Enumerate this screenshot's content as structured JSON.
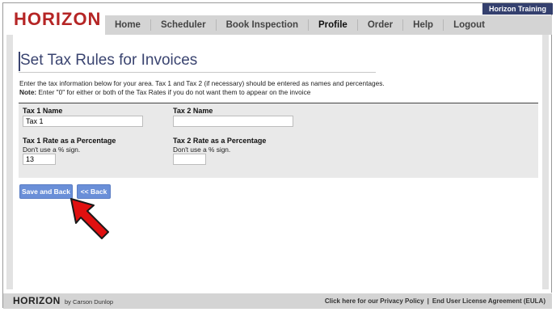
{
  "header": {
    "logo_text": "HORIZON",
    "training_badge": "Horizon Training"
  },
  "nav": {
    "items": [
      {
        "label": "Home"
      },
      {
        "label": "Scheduler"
      },
      {
        "label": "Book Inspection"
      },
      {
        "label": "Profile"
      },
      {
        "label": "Order"
      },
      {
        "label": "Help"
      },
      {
        "label": "Logout"
      }
    ],
    "active": "Profile"
  },
  "page": {
    "title": "Set Tax Rules for Invoices",
    "description": "Enter the tax information below for your area. Tax 1 and Tax 2 (if necessary) should be entered as names and percentages.",
    "note_label": "Note:",
    "note_text": "Enter \"0\" for either or both of the Tax Rates if you do not want them to appear on the invoice"
  },
  "form": {
    "tax1_name_label": "Tax 1 Name",
    "tax1_name_value": "Tax 1",
    "tax2_name_label": "Tax 2 Name",
    "tax2_name_value": "",
    "tax1_rate_label": "Tax 1 Rate as a Percentage",
    "tax1_rate_hint": "Don't use a % sign.",
    "tax1_rate_value": "13",
    "tax2_rate_label": "Tax 2 Rate as a Percentage",
    "tax2_rate_hint": "Don't use a % sign.",
    "tax2_rate_value": ""
  },
  "actions": {
    "save_back_label": "Save and Back",
    "back_label": "<< Back"
  },
  "footer": {
    "logo_text": "HORIZON",
    "by_text": "by Carson Dunlop",
    "privacy_link": "Click here for our Privacy Policy",
    "separator": "|",
    "eula_link": "End User License Agreement (EULA)"
  },
  "colors": {
    "brand_red": "#b52525",
    "navy": "#34406e",
    "button_blue": "#6a8fd8",
    "arrow_red": "#e01010"
  }
}
